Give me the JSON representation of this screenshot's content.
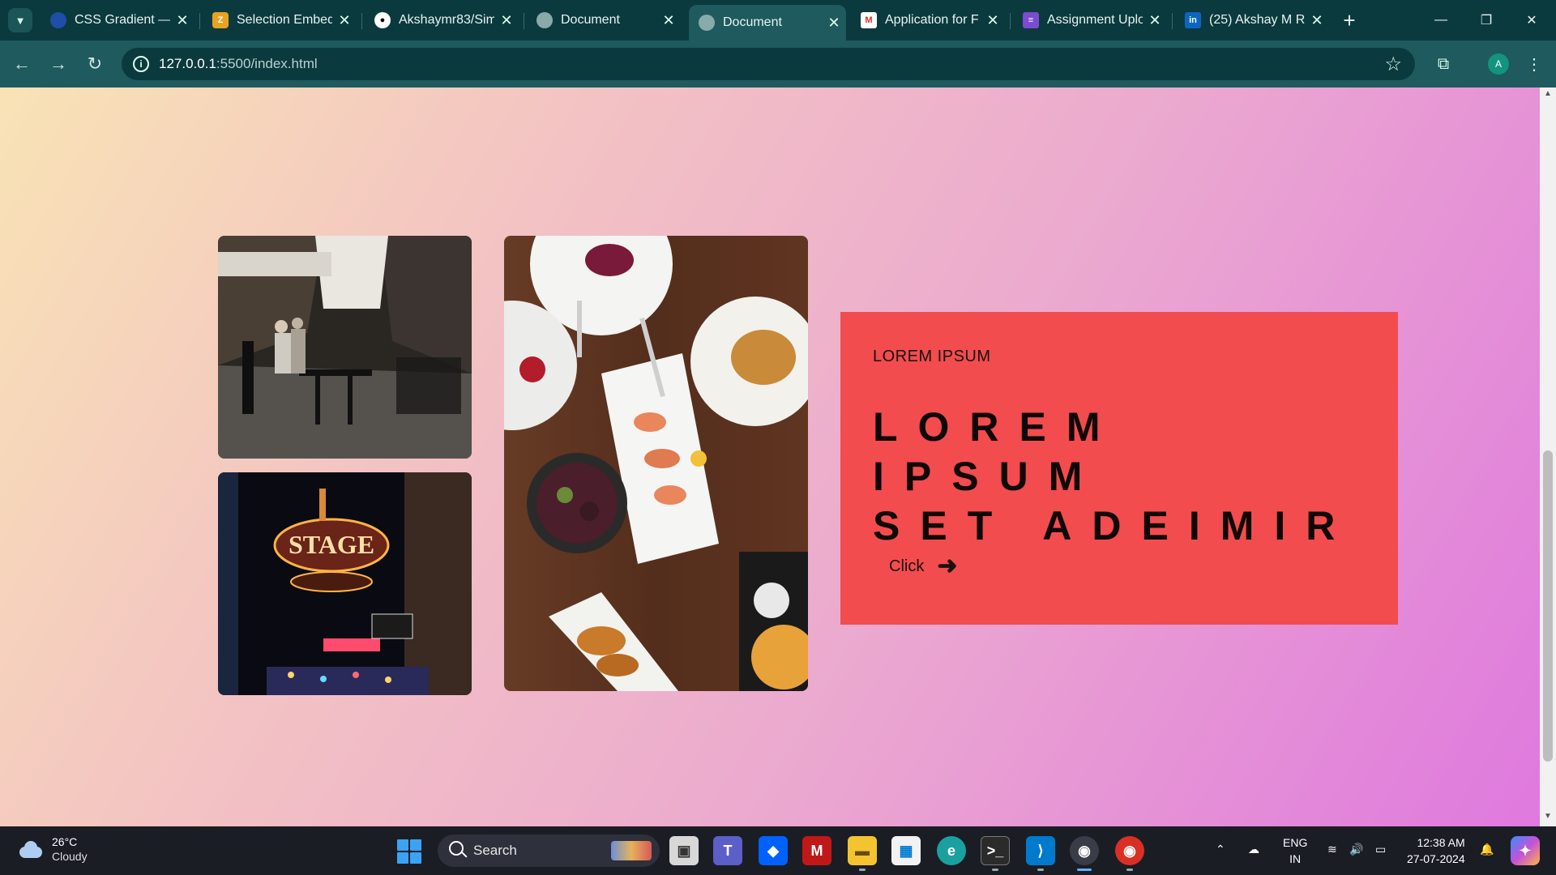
{
  "browser": {
    "tabs": [
      {
        "title": "CSS Gradient —",
        "favicon": "globe-blue-icon",
        "active": false
      },
      {
        "title": "Selection Embed",
        "favicon": "app-logo-icon",
        "active": false
      },
      {
        "title": "Akshaymr83/Sim",
        "favicon": "github-icon",
        "active": false
      },
      {
        "title": "Document",
        "favicon": "globe-icon",
        "active": false
      },
      {
        "title": "Document",
        "favicon": "globe-icon",
        "active": true
      },
      {
        "title": "Application for F",
        "favicon": "gmail-icon",
        "active": false
      },
      {
        "title": "Assignment Uplo",
        "favicon": "forms-icon",
        "active": false
      },
      {
        "title": "(25) Akshay M R",
        "favicon": "linkedin-icon",
        "active": false
      }
    ],
    "url_host": "127.0.0.1",
    "url_path": ":5500/index.html",
    "profile_initial": "A"
  },
  "page": {
    "hero": {
      "kicker": "LOREM IPSUM",
      "title_line1": "LOREM IPSUM",
      "title_line2": "SET ADEIMIR",
      "button_label": "Click",
      "arrow": "➜",
      "card_color": "#f24c4e"
    },
    "images": [
      "street-cafe-photo",
      "neon-stage-sign-photo",
      "food-table-photo"
    ]
  },
  "taskbar": {
    "weather_temp": "26°C",
    "weather_desc": "Cloudy",
    "search_label": "Search",
    "lang_top": "ENG",
    "lang_bottom": "IN",
    "time": "12:38 AM",
    "date": "27-07-2024"
  },
  "colors": {
    "gradient_start": "#f9e3b5",
    "gradient_end": "#df79de",
    "browser_frame": "#0b3a3e",
    "toolbar": "#1e5a5e"
  }
}
